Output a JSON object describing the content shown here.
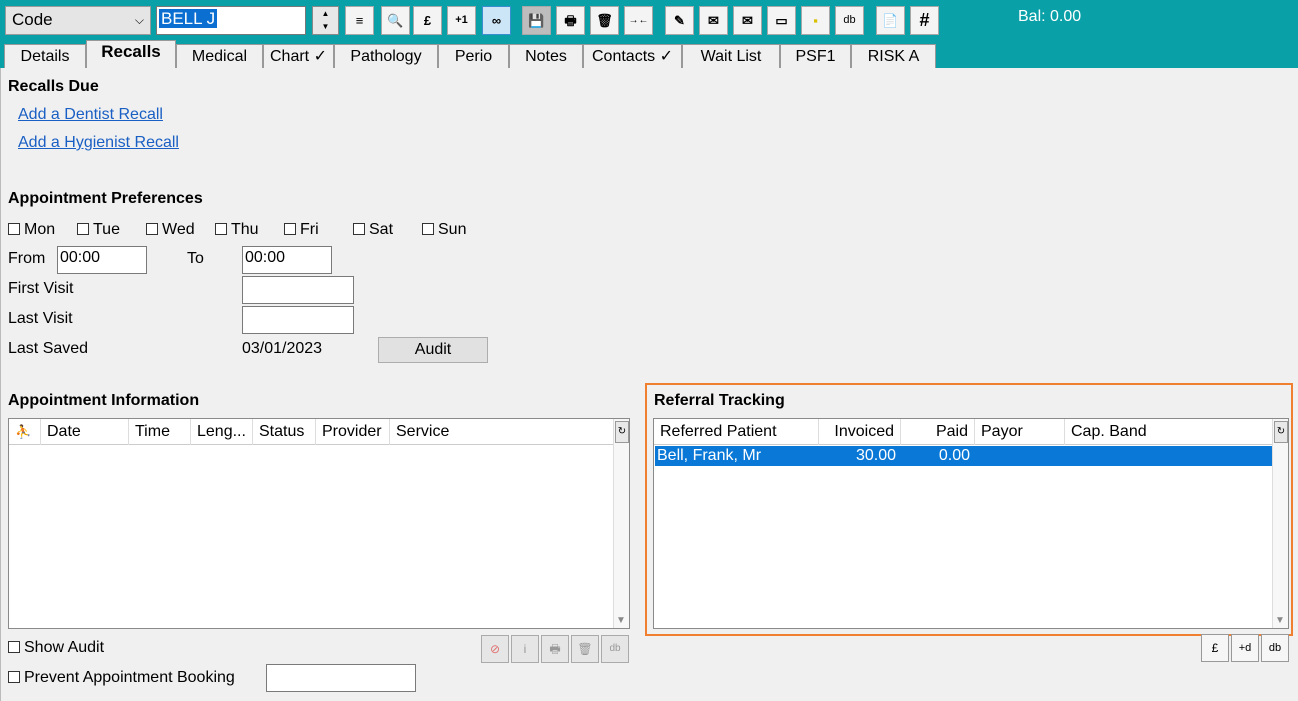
{
  "toolbar": {
    "combo_value": "Code",
    "patient_name": "BELL J",
    "buttons": [
      "≡",
      "🔍",
      "£",
      "+1",
      "∞",
      "💾",
      "🖶",
      "🗑",
      "→←",
      "✎",
      "✉",
      "✉",
      "▭",
      "▪",
      "db",
      "📄",
      "#"
    ],
    "balance": "Bal: 0.00"
  },
  "tabs": [
    "Details",
    "Recalls",
    "Medical",
    "Chart ✓",
    "Pathology",
    "Perio",
    "Notes",
    "Contacts ✓",
    "Wait List",
    "PSF1",
    "RISK A"
  ],
  "recalls": {
    "heading": "Recalls Due",
    "add_dentist": "Add a Dentist Recall",
    "add_hygienist": "Add a Hygienist Recall"
  },
  "prefs": {
    "heading": "Appointment Preferences",
    "days": [
      "Mon",
      "Tue",
      "Wed",
      "Thu",
      "Fri",
      "Sat",
      "Sun"
    ],
    "from_label": "From",
    "from_value": "00:00",
    "to_label": "To",
    "to_value": "00:00",
    "first_visit_label": "First Visit",
    "first_visit_value": "",
    "last_visit_label": "Last Visit",
    "last_visit_value": "",
    "last_saved_label": "Last Saved",
    "last_saved_value": "03/01/2023",
    "audit_button": "Audit"
  },
  "appointments": {
    "heading": "Appointment Information",
    "columns": [
      "⛹",
      "Date",
      "Time",
      "Leng...",
      "Status",
      "Provider",
      "Service"
    ],
    "show_audit": "Show Audit",
    "prevent_booking": "Prevent Appointment Booking",
    "prevent_value": ""
  },
  "referral": {
    "heading": "Referral Tracking",
    "columns": [
      "Referred Patient",
      "Invoiced",
      "Paid",
      "Payor",
      "Cap. Band"
    ],
    "rows": [
      {
        "patient": "Bell, Frank, Mr",
        "invoiced": "30.00",
        "paid": "0.00",
        "payor": "",
        "band": ""
      }
    ]
  }
}
